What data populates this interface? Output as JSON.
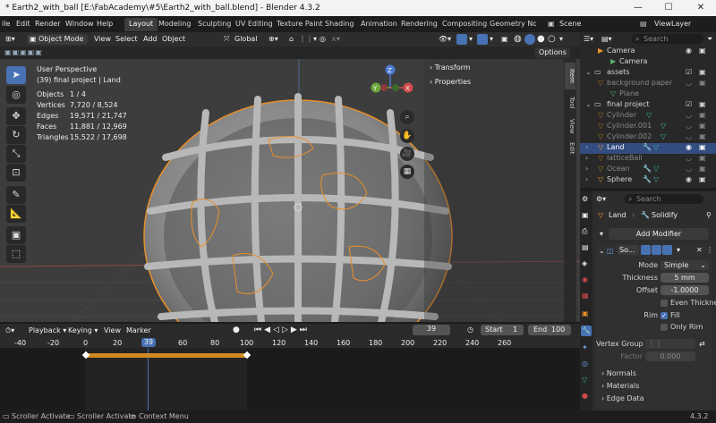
{
  "window": {
    "title": "* Earth2_with_ball [E:\\FabAcademy\\#5\\Earth2_with_ball.blend] - Blender 4.3.2",
    "minimize": "—",
    "maximize": "☐",
    "close": "✕"
  },
  "menus": [
    "ile",
    "Edit",
    "Render",
    "Window",
    "Help"
  ],
  "workspaces": [
    "Layout",
    "Modeling",
    "Sculpting",
    "UV Editing",
    "Texture Paint",
    "Shading",
    "Animation",
    "Rendering",
    "Compositing",
    "Geometry Node"
  ],
  "scene": {
    "label": "Scene",
    "viewlayer": "ViewLayer"
  },
  "viewport_header": {
    "mode": "Object Mode",
    "menus": [
      "View",
      "Select",
      "Add",
      "Object"
    ],
    "transform": "Global",
    "options": "Options"
  },
  "overlay": {
    "perspective": "User Perspective",
    "context": "(39) final project | Land",
    "stats": [
      {
        "k": "Objects",
        "v": "1 / 4"
      },
      {
        "k": "Vertices",
        "v": "7,720 / 8,524"
      },
      {
        "k": "Edges",
        "v": "19,571 / 21,747"
      },
      {
        "k": "Faces",
        "v": "11,881 / 12,969"
      },
      {
        "k": "Triangles",
        "v": "15,522 / 17,698"
      }
    ],
    "panels": [
      "Transform",
      "Properties"
    ],
    "side_tabs": [
      "Item",
      "Tool",
      "View",
      "Edit"
    ],
    "gizmo": {
      "x": "X",
      "y": "Y",
      "z": "Z"
    }
  },
  "timeline": {
    "menus": [
      "Playback",
      "Keying",
      "View",
      "Marker"
    ],
    "current": "39",
    "start_label": "Start",
    "start": "1",
    "end_label": "End",
    "end": "100",
    "ticks": [
      "-40",
      "-20",
      "0",
      "20",
      "39",
      "60",
      "80",
      "100",
      "120",
      "140",
      "160",
      "180",
      "200",
      "220",
      "240",
      "260"
    ]
  },
  "status": {
    "items": [
      "Scroller Activate",
      "Scroller Activate",
      "Context Menu"
    ],
    "version": "4.3.2"
  },
  "outliner": {
    "search": "Search",
    "rows": [
      {
        "name": "Camera",
        "indent": 1,
        "type": "object"
      },
      {
        "name": "Camera",
        "indent": 2,
        "type": "data"
      },
      {
        "name": "assets",
        "indent": 0,
        "type": "collection"
      },
      {
        "name": "background paper",
        "indent": 1,
        "type": "object"
      },
      {
        "name": "Plane",
        "indent": 2,
        "type": "data"
      },
      {
        "name": "final project",
        "indent": 0,
        "type": "collection"
      },
      {
        "name": "Cylinder",
        "indent": 1,
        "type": "object"
      },
      {
        "name": "Cylinder.001",
        "indent": 1,
        "type": "object"
      },
      {
        "name": "Cylinder.002",
        "indent": 1,
        "type": "object"
      },
      {
        "name": "Land",
        "indent": 1,
        "type": "object",
        "selected": true
      },
      {
        "name": "latticeBall",
        "indent": 1,
        "type": "object"
      },
      {
        "name": "Ocean",
        "indent": 1,
        "type": "object"
      },
      {
        "name": "Sphere",
        "indent": 1,
        "type": "object"
      }
    ]
  },
  "properties": {
    "search": "Search",
    "breadcrumb_obj": "Land",
    "breadcrumb_mod": "Solidify",
    "add_modifier": "Add Modifier",
    "modifier_name": "So...",
    "mode_label": "Mode",
    "mode_value": "Simple",
    "thickness_label": "Thickness",
    "thickness_value": "5 mm",
    "offset_label": "Offset",
    "offset_value": "-1.0000",
    "even": "Even Thickness",
    "rim_label": "Rim",
    "fill": "Fill",
    "only_rim": "Only Rim",
    "vgroup_label": "Vertex Group",
    "factor_label": "Factor",
    "factor_value": "0.000",
    "sections": [
      "Normals",
      "Materials",
      "Edge Data"
    ]
  },
  "colors": {
    "accent": "#4772b3",
    "orange": "#e8902a",
    "select": "#334d80"
  }
}
